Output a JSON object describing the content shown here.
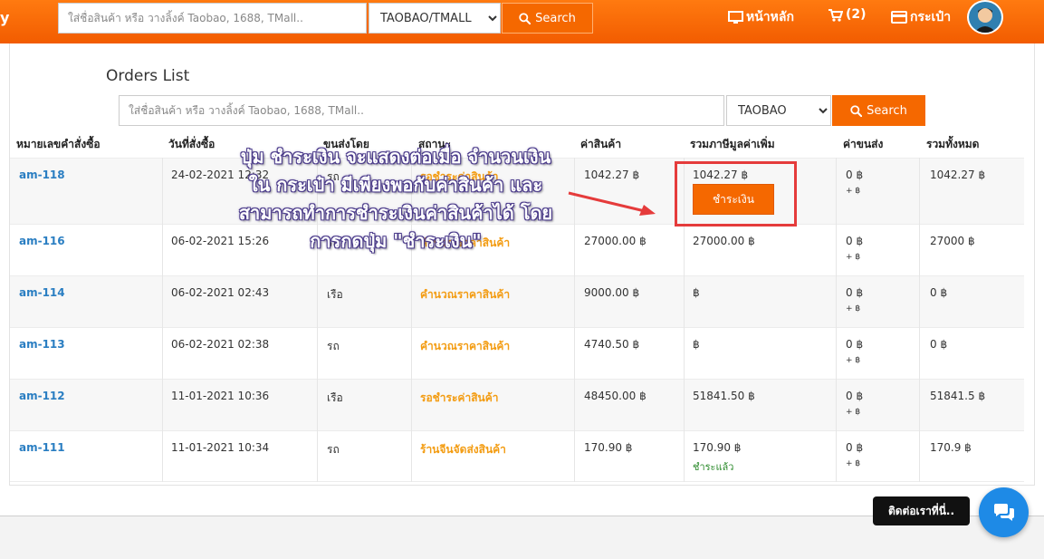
{
  "header": {
    "brand": "y",
    "search_placeholder": "ใส่ชื่อสินค้า หรือ วางลิ้งค์ Taobao, 1688, TMall..",
    "platform_selected": "TAOBAO/TMALL",
    "search_button": "Search",
    "nav_home": "หน้าหลัก",
    "nav_cart": "(2)",
    "nav_wallet": "กระเป๋า"
  },
  "orders": {
    "title": "Orders List",
    "search_placeholder": "ใส่ชื่อสินค้า หรือ วางลิ้งค์ Taobao, 1688, TMall..",
    "platform_selected": "TAOBAO",
    "search_button": "Search",
    "columns": [
      "หมายเลขคำสั่งซื้อ",
      "วันที่สั่งซื้อ",
      "ขนส่งโดย",
      "สถานะ",
      "ค่าสินค้า",
      "รวมภาษีมูลค่าเพิ่ม",
      "ค่าขนส่ง",
      "รวมทั้งหมด"
    ],
    "rows": [
      {
        "id": "am-118",
        "date": "24-02-2021 12:32",
        "ship": "รถ",
        "status": "รอชำระค่าสินค้า",
        "price": "1042.27 ฿",
        "vat": "1042.27 ฿",
        "shipping": "0 ฿",
        "shipping_extra": "+ ฿",
        "total": "1042.27 ฿"
      },
      {
        "id": "am-116",
        "date": "06-02-2021 15:26",
        "ship": "รถ",
        "status": "คำนวณราคาสินค้า",
        "price": "27000.00 ฿",
        "vat": "27000.00 ฿",
        "shipping": "0 ฿",
        "shipping_extra": "+ ฿",
        "total": "27000 ฿"
      },
      {
        "id": "am-114",
        "date": "06-02-2021 02:43",
        "ship": "เรือ",
        "status": "คำนวณราคาสินค้า",
        "price": "9000.00 ฿",
        "vat": "฿",
        "shipping": "0 ฿",
        "shipping_extra": "+ ฿",
        "total": "0 ฿"
      },
      {
        "id": "am-113",
        "date": "06-02-2021 02:38",
        "ship": "รถ",
        "status": "คำนวณราคาสินค้า",
        "price": "4740.50 ฿",
        "vat": "฿",
        "shipping": "0 ฿",
        "shipping_extra": "+ ฿",
        "total": "0 ฿"
      },
      {
        "id": "am-112",
        "date": "11-01-2021 10:36",
        "ship": "เรือ",
        "status": "รอชำระค่าสินค้า",
        "price": "48450.00 ฿",
        "vat": "51841.50 ฿",
        "shipping": "0 ฿",
        "shipping_extra": "+ ฿",
        "total": "51841.5 ฿"
      },
      {
        "id": "am-111",
        "date": "11-01-2021 10:34",
        "ship": "รถ",
        "status": "ร้านจีนจัดส่งสินค้า",
        "price": "170.90 ฿",
        "vat": "170.90 ฿",
        "shipping": "0 ฿",
        "shipping_extra": "+ ฿",
        "total": "170.9 ฿"
      }
    ],
    "pay_button": "ชำระเงิน",
    "paid_label": "ชำระแล้ว"
  },
  "annotation": {
    "line1": "ปุ่ม ชำระเงิน จะแสดงต่อเมื่อ จำนวนเงิน",
    "line2": "ใน กระเป๋า มีเพียงพอกับค่าสินค้า และ",
    "line3": "สามารถทำการชำระเงินค่าสินค้าได้ โดย",
    "line4": "การกดปุ่ม \"ชำระเงิน\""
  },
  "contact": {
    "label": "ติดต่อเราที่นี่.."
  },
  "colors": {
    "accent": "#f56800",
    "link": "#2a7ec2",
    "status": "#f39c12",
    "paid": "#2a8a2a",
    "highlight": "#e53b3b",
    "chat": "#1e8ae6"
  }
}
